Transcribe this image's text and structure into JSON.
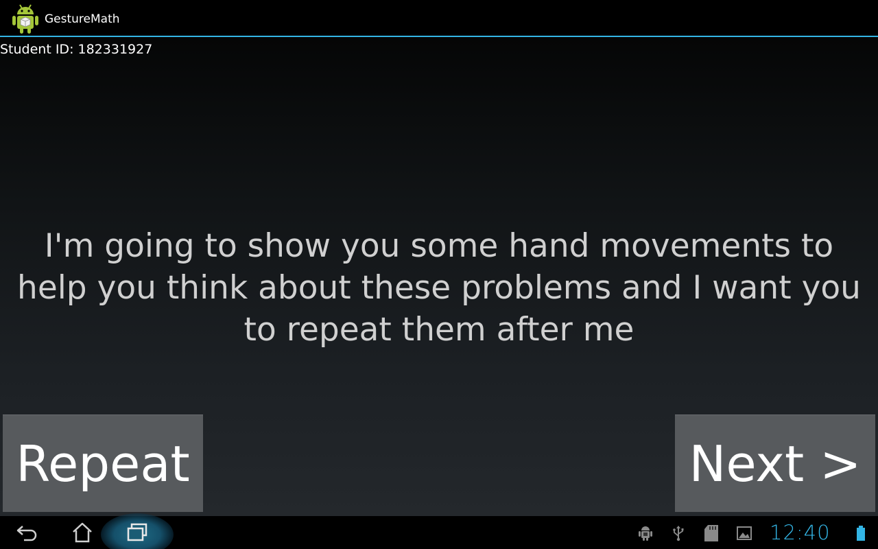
{
  "app": {
    "title": "GestureMath",
    "icon": "android-robot-icon"
  },
  "content": {
    "student_id_label": "Student ID: 182331927",
    "message": "I'm going to show you some hand movements to help you think about these problems and I want you to repeat them after me"
  },
  "buttons": {
    "repeat_label": "Repeat",
    "next_label": "Next >"
  },
  "system_bar": {
    "nav": [
      "back-icon",
      "home-icon",
      "recent-apps-icon"
    ],
    "status_icons": [
      "android-debug-icon",
      "usb-icon",
      "sd-card-icon",
      "image-icon"
    ],
    "clock": "12:40",
    "battery_icon": "battery-icon"
  },
  "colors": {
    "accent": "#33b5e5",
    "button_bg": "#575a5d",
    "message_text": "#d0d0d0"
  }
}
